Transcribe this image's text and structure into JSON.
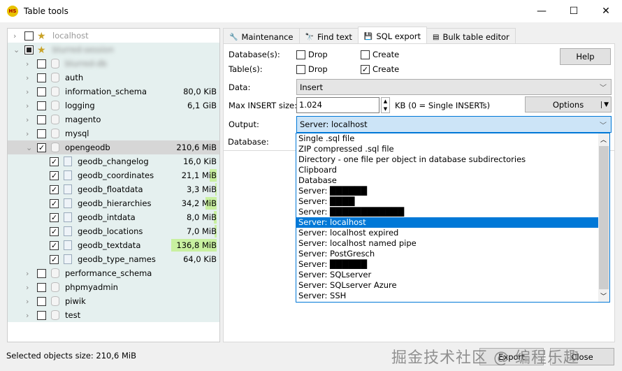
{
  "window": {
    "title": "Table tools",
    "minimize": "—",
    "maximize": "☐",
    "close": "✕",
    "app_icon": "HS"
  },
  "tree": [
    {
      "level": 0,
      "exp": ">",
      "check": "none",
      "label": "localhost",
      "size": "",
      "gray": true,
      "icon": "server"
    },
    {
      "level": 0,
      "exp": "v",
      "check": "partial",
      "label": "blurred-session",
      "size": "",
      "blur": true,
      "icon": "server"
    },
    {
      "level": 1,
      "exp": ">",
      "check": "none",
      "label": "blurred-db",
      "size": "",
      "blur": true,
      "icon": "db"
    },
    {
      "level": 1,
      "exp": ">",
      "check": "none",
      "label": "auth",
      "size": "",
      "icon": "db"
    },
    {
      "level": 1,
      "exp": ">",
      "check": "none",
      "label": "information_schema",
      "size": "80,0 KiB",
      "icon": "db"
    },
    {
      "level": 1,
      "exp": ">",
      "check": "none",
      "label": "logging",
      "size": "6,1 GiB",
      "icon": "db"
    },
    {
      "level": 1,
      "exp": ">",
      "check": "none",
      "label": "magento",
      "size": "",
      "icon": "db"
    },
    {
      "level": 1,
      "exp": ">",
      "check": "none",
      "label": "mysql",
      "size": "",
      "icon": "db"
    },
    {
      "level": 1,
      "exp": "v",
      "check": "checked",
      "label": "opengeodb",
      "size": "210,6 MiB",
      "icon": "db",
      "selected": true
    },
    {
      "level": 2,
      "check": "checked",
      "label": "geodb_changelog",
      "size": "16,0 KiB",
      "icon": "table",
      "bar": 0.0
    },
    {
      "level": 2,
      "check": "checked",
      "label": "geodb_coordinates",
      "size": "21,1 MiB",
      "icon": "table",
      "bar": 0.1
    },
    {
      "level": 2,
      "check": "checked",
      "label": "geodb_floatdata",
      "size": "3,3 MiB",
      "icon": "table",
      "bar": 0.02
    },
    {
      "level": 2,
      "check": "checked",
      "label": "geodb_hierarchies",
      "size": "34,2 MiB",
      "icon": "table",
      "bar": 0.16
    },
    {
      "level": 2,
      "check": "checked",
      "label": "geodb_intdata",
      "size": "8,0 MiB",
      "icon": "table",
      "bar": 0.04
    },
    {
      "level": 2,
      "check": "checked",
      "label": "geodb_locations",
      "size": "7,0 MiB",
      "icon": "table",
      "bar": 0.03
    },
    {
      "level": 2,
      "check": "checked",
      "label": "geodb_textdata",
      "size": "136,8 MiB",
      "icon": "table",
      "bar": 0.65
    },
    {
      "level": 2,
      "check": "checked",
      "label": "geodb_type_names",
      "size": "64,0 KiB",
      "icon": "table",
      "bar": 0.0
    },
    {
      "level": 1,
      "exp": ">",
      "check": "none",
      "label": "performance_schema",
      "size": "",
      "icon": "db"
    },
    {
      "level": 1,
      "exp": ">",
      "check": "none",
      "label": "phpmyadmin",
      "size": "",
      "icon": "db"
    },
    {
      "level": 1,
      "exp": ">",
      "check": "none",
      "label": "piwik",
      "size": "",
      "icon": "db"
    },
    {
      "level": 1,
      "exp": ">",
      "check": "none",
      "label": "test",
      "size": "",
      "icon": "db"
    }
  ],
  "tabs": [
    {
      "label": "Maintenance",
      "icon": "🔧"
    },
    {
      "label": "Find text",
      "icon": "🔭"
    },
    {
      "label": "SQL export",
      "icon": "💾",
      "active": true
    },
    {
      "label": "Bulk table editor",
      "icon": "▤"
    }
  ],
  "form": {
    "databases_label": "Database(s):",
    "tables_label": "Table(s):",
    "drop": "Drop",
    "create": "Create",
    "db_drop": false,
    "db_create": false,
    "tbl_drop": false,
    "tbl_create": true,
    "help": "Help",
    "data_label": "Data:",
    "data_value": "Insert",
    "max_insert_label": "Max INSERT size:",
    "max_insert_value": "1.024",
    "max_insert_hint": "KB (0 = Single INSERTs)",
    "options": "Options",
    "output_label": "Output:",
    "output_value": "Server: localhost",
    "database_label": "Database:"
  },
  "output_options": [
    "Single .sql file",
    "ZIP compressed .sql file",
    "Directory - one file per object in database subdirectories",
    "Clipboard",
    "Database",
    "Server: ██████",
    "Server: ████",
    "Server: ████████████",
    "Server: localhost",
    "Server: localhost expired",
    "Server: localhost named pipe",
    "Server: PostGresch",
    "Server: ██████",
    "Server: SQLserver",
    "Server: SQLserver Azure",
    "Server: SSH"
  ],
  "output_selected_index": 8,
  "footer": {
    "status": "Selected objects size: 210,6 MiB",
    "export": "Export",
    "close": "Close"
  },
  "watermark": "掘金技术社区 @ 编程乐趣"
}
